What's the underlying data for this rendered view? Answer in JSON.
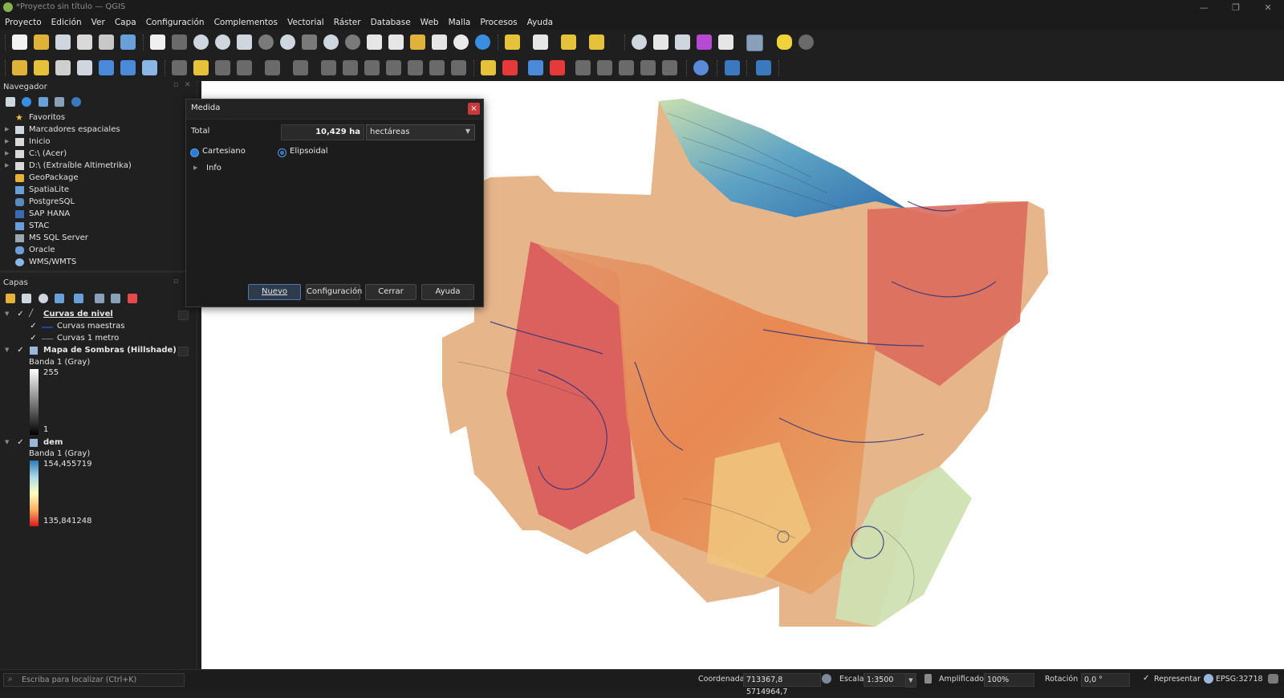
{
  "window": {
    "title": "*Proyecto sin título — QGIS",
    "controls": [
      "—",
      "❐",
      "✕"
    ]
  },
  "menu": [
    "Proyecto",
    "Edición",
    "Ver",
    "Capa",
    "Configuración",
    "Complementos",
    "Vectorial",
    "Ráster",
    "Database",
    "Web",
    "Malla",
    "Procesos",
    "Ayuda"
  ],
  "navigator": {
    "title": "Navegador",
    "items": [
      {
        "label": "Favoritos",
        "icon": "star-icon",
        "expandable": false
      },
      {
        "label": "Marcadores espaciales",
        "icon": "bookmark-icon",
        "expandable": true
      },
      {
        "label": "Inicio",
        "icon": "home-folder-icon",
        "expandable": true
      },
      {
        "label": "C:\\ (Acer)",
        "icon": "folder-icon",
        "expandable": true
      },
      {
        "label": "D:\\ (Extraíble Altimetrika)",
        "icon": "folder-icon",
        "expandable": true
      },
      {
        "label": "GeoPackage",
        "icon": "geopackage-icon",
        "expandable": false
      },
      {
        "label": "SpatiaLite",
        "icon": "spatialite-icon",
        "expandable": false
      },
      {
        "label": "PostgreSQL",
        "icon": "postgresql-icon",
        "expandable": false
      },
      {
        "label": "SAP HANA",
        "icon": "sap-hana-icon",
        "expandable": false
      },
      {
        "label": "STAC",
        "icon": "stac-icon",
        "expandable": false
      },
      {
        "label": "MS SQL Server",
        "icon": "mssql-icon",
        "expandable": false
      },
      {
        "label": "Oracle",
        "icon": "oracle-icon",
        "expandable": false
      },
      {
        "label": "WMS/WMTS",
        "icon": "wms-icon",
        "expandable": false
      }
    ]
  },
  "layers": {
    "title": "Capas",
    "curvas": {
      "name": "Curvas de nivel",
      "children": [
        "Curvas maestras",
        "Curvas 1 metro"
      ]
    },
    "hillshade": {
      "name": "Mapa de Sombras (Hillshade)",
      "band": "Banda 1 (Gray)",
      "max": "255",
      "min": "1"
    },
    "dem": {
      "name": "dem",
      "band": "Banda 1 (Gray)",
      "max": "154,455719",
      "min": "135,841248"
    }
  },
  "measure_dialog": {
    "title": "Medida",
    "total_label": "Total",
    "total_value": "10,429 ha",
    "unit": "hectáreas",
    "option_cartesian": "Cartesiano",
    "option_ellipsoidal": "Elipsoidal",
    "info_label": "Info",
    "buttons": {
      "new": "Nuevo",
      "config": "Configuración",
      "close": "Cerrar",
      "help": "Ayuda"
    },
    "close_glyph": "×"
  },
  "status": {
    "search_placeholder": "Escriba para localizar (Ctrl+K)",
    "coordinate_label": "Coordenada",
    "coordinate_value": "713367,8  5714964,7",
    "scale_label": "Escala",
    "scale_value": "1:3500",
    "magnifier_label": "Amplificador",
    "magnifier_value": "100%",
    "rotation_label": "Rotación",
    "rotation_value": "0,0 °",
    "render_label": "Representar",
    "crs": "EPSG:32718"
  },
  "colors": {
    "accent": "#2b7bd4",
    "map_red": "#d64a4a",
    "map_orange": "#e8924e",
    "map_yellow": "#f1d58a",
    "map_green": "#c4dcaa",
    "map_blue": "#3a7ebb",
    "contour": "#1f2f7a"
  }
}
